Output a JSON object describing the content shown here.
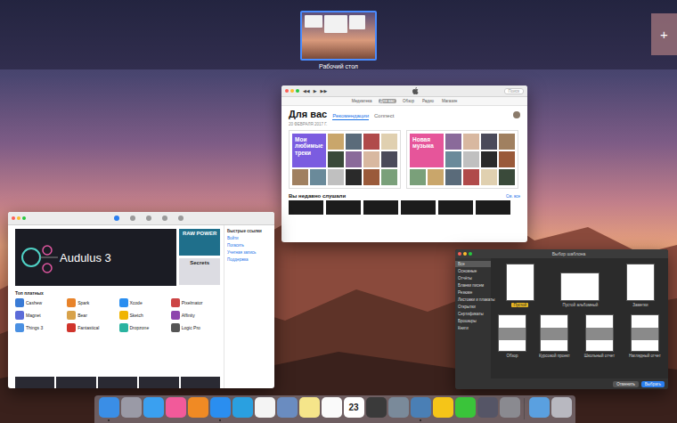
{
  "spaces": {
    "desktops": [
      {
        "label": "Рабочий стол",
        "selected": true
      }
    ],
    "add_button": "+"
  },
  "itunes": {
    "controls": [
      "◀◀",
      "▶",
      "▶▶"
    ],
    "search": "Поиск",
    "nav": [
      {
        "label": "Медиатека",
        "selected": false
      },
      {
        "label": "Для вас",
        "selected": true
      },
      {
        "label": "Обзор",
        "selected": false
      },
      {
        "label": "Радио",
        "selected": false
      },
      {
        "label": "Магазин",
        "selected": false
      }
    ],
    "heading": "Для вас",
    "tabs": [
      {
        "label": "Рекомендации",
        "selected": true
      },
      {
        "label": "Connect",
        "selected": false
      }
    ],
    "date": "20 ФЕВРАЛЯ 2017 Г.",
    "mixes": [
      {
        "title": "Мои любимые треки",
        "color": "#7b5ce0"
      },
      {
        "title": "Новая музыка",
        "color": "#e6559a"
      }
    ],
    "recent_heading": "Вы недавно слушали",
    "see_all": "См. все"
  },
  "app_store": {
    "tabs": [
      {
        "selected": true
      },
      {
        "selected": false
      },
      {
        "selected": false
      },
      {
        "selected": false
      },
      {
        "selected": false
      }
    ],
    "banner": "Audulus 3",
    "promos": [
      {
        "title": "RAW POWER",
        "color": "#1f6f8b"
      },
      {
        "title": "Secrets",
        "color": "#dcdce2"
      }
    ],
    "section": "Топ платных",
    "apps": [
      {
        "name": "Cashew",
        "color": "#3a7bd5"
      },
      {
        "name": "Spark",
        "color": "#e8832a"
      },
      {
        "name": "Xcode",
        "color": "#2a8ef0"
      },
      {
        "name": "Pixelmator",
        "color": "#c44"
      },
      {
        "name": "Magnet",
        "color": "#5b6bd8"
      },
      {
        "name": "Bear",
        "color": "#d8a24a"
      },
      {
        "name": "Sketch",
        "color": "#f0b400"
      },
      {
        "name": "Affinity",
        "color": "#8e44ad"
      },
      {
        "name": "Things 3",
        "color": "#4a90e2"
      },
      {
        "name": "Fantastical",
        "color": "#d0342c"
      },
      {
        "name": "Dropzone",
        "color": "#2ab3a0"
      },
      {
        "name": "Logic Pro",
        "color": "#555"
      }
    ],
    "links": [
      "Быстрые ссылки",
      "Войти",
      "Погасить",
      "Учетная запись",
      "Поддержка"
    ]
  },
  "pages": {
    "title": "Выбор шаблона",
    "categories": [
      {
        "label": "Все",
        "selected": true
      },
      {
        "label": "Основные",
        "selected": false
      },
      {
        "label": "Отчёты",
        "selected": false
      },
      {
        "label": "Бланки писем",
        "selected": false
      },
      {
        "label": "Резюме",
        "selected": false
      },
      {
        "label": "Листовки и плакаты",
        "selected": false
      },
      {
        "label": "Открытки",
        "selected": false
      },
      {
        "label": "Сертификаты",
        "selected": false
      },
      {
        "label": "Брошюры",
        "selected": false
      },
      {
        "label": "Книги",
        "selected": false
      }
    ],
    "templates": [
      [
        {
          "label": "Пустой",
          "kind": "portrait",
          "selected": true
        },
        {
          "label": "Пустой альбомный",
          "kind": "landscape",
          "selected": false
        },
        {
          "label": "Заметки",
          "kind": "portrait",
          "selected": false
        }
      ],
      [
        {
          "label": "Обзор",
          "kind": "photo",
          "selected": false
        },
        {
          "label": "Курсовой проект",
          "kind": "photo",
          "selected": false
        },
        {
          "label": "Школьный отчет",
          "kind": "photo",
          "selected": false
        },
        {
          "label": "Наглядный отчет",
          "kind": "photo",
          "selected": false
        }
      ]
    ],
    "buttons": [
      "Отменить",
      "Выбрать"
    ]
  },
  "dock": {
    "apps": [
      {
        "color": "#3a8ee6",
        "running": true
      },
      {
        "color": "#9a9aa6",
        "running": false
      },
      {
        "color": "#3aa0f0",
        "running": false
      },
      {
        "color": "#f25a9a",
        "running": false
      },
      {
        "color": "#f08a24",
        "running": false
      },
      {
        "color": "#2a8ef0",
        "running": true
      },
      {
        "color": "#2aa0e0",
        "running": false
      },
      {
        "color": "#f4f4f4",
        "running": false
      },
      {
        "color": "#6a8cc0",
        "running": false
      },
      {
        "color": "#f5e58a",
        "running": false
      },
      {
        "color": "#fafafa",
        "running": false
      },
      {
        "color": "#ffffff",
        "running": false,
        "label": "23"
      },
      {
        "color": "#3a3a3a",
        "running": false
      },
      {
        "color": "#7a8a9a",
        "running": false
      },
      {
        "color": "#4a7fb5",
        "running": true
      },
      {
        "color": "#f5c518",
        "running": false
      },
      {
        "color": "#3ac43a",
        "running": false
      },
      {
        "color": "#555566",
        "running": false
      },
      {
        "color": "#8a8a90",
        "running": false
      }
    ],
    "stacks": [
      {
        "color": "#5aa0e0",
        "running": false
      },
      {
        "color": "#b8b8c0",
        "running": false
      }
    ]
  }
}
